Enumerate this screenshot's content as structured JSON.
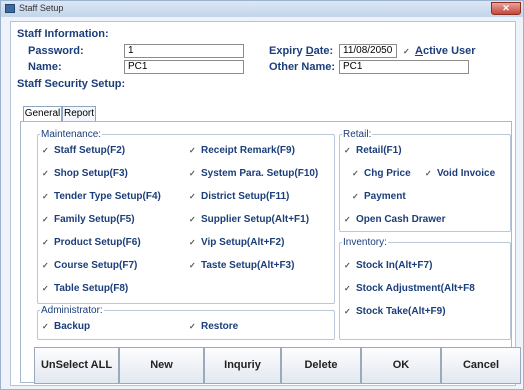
{
  "window": {
    "title": "Staff Setup",
    "close_glyph": "✕"
  },
  "staff_info": {
    "title": "Staff Information:",
    "password_label": "Password:",
    "password_value": "1",
    "expiry_label_pre": "Expiry ",
    "expiry_label_ul": "D",
    "expiry_label_post": "ate:",
    "expiry_value": "11/08/2050",
    "active_user_ul": "A",
    "active_user_rest": "ctive User",
    "name_label": "Name:",
    "name_value": "PC1",
    "other_name_label": "Other Name:",
    "other_name_value": "PC1"
  },
  "security": {
    "title": "Staff Security Setup:",
    "tabs": [
      "General",
      "Report"
    ],
    "groups": {
      "maintenance": "Maintenance:",
      "administrator": "Administrator:",
      "retail": "Retail:",
      "inventory": "Inventory:"
    },
    "maintenance_left": [
      "Staff Setup(F2)",
      "Shop Setup(F3)",
      "Tender Type Setup(F4)",
      "Family Setup(F5)",
      "Product Setup(F6)",
      "Course Setup(F7)",
      "Table Setup(F8)"
    ],
    "maintenance_right": [
      "Receipt Remark(F9)",
      "System Para. Setup(F10)",
      "District Setup(F11)",
      "Supplier Setup(Alt+F1)",
      "Vip Setup(Alt+F2)",
      "Taste Setup(Alt+F3)"
    ],
    "administrator_items": [
      "Backup",
      "Restore"
    ],
    "retail_items": [
      "Retail(F1)",
      "Chg Price",
      "Void Invoice",
      "Payment",
      "Open Cash Drawer"
    ],
    "inventory_items": [
      "Stock In(Alt+F7)",
      "Stock Adjustment(Alt+F8",
      "Stock Take(Alt+F9)"
    ],
    "check_glyph": "✓"
  },
  "buttons": [
    "UnSelect ALL",
    "New",
    "Inquriy",
    "Delete",
    "OK",
    "Cancel"
  ]
}
